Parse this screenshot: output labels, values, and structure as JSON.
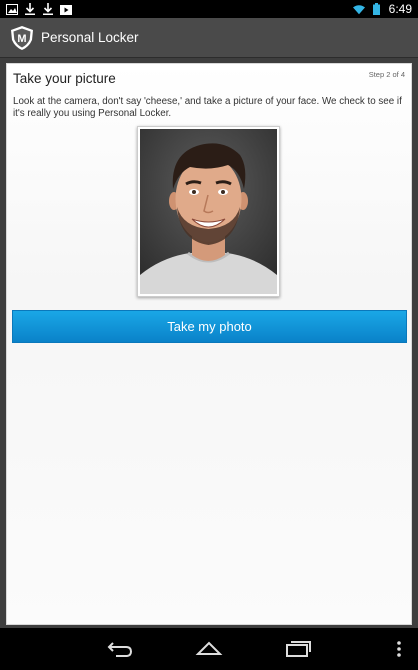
{
  "status_bar": {
    "time": "6:49",
    "icons": [
      "gallery-icon",
      "download-icon",
      "download-icon",
      "video-icon",
      "wifi-icon",
      "battery-icon"
    ]
  },
  "action_bar": {
    "logo_letter": "M",
    "title": "Personal Locker"
  },
  "card": {
    "title": "Take your picture",
    "step": "Step 2 of 4",
    "instructions": "Look at the camera, don't say 'cheese,' and take a picture of your face. We check to see if it's really you using Personal Locker.",
    "button_label": "Take my photo"
  },
  "colors": {
    "accent": "#0a95d9",
    "action_bar": "#4a4a4a",
    "wifi": "#33b5e5"
  },
  "nav_bar": {
    "icons": [
      "back-icon",
      "home-icon",
      "recent-apps-icon",
      "overflow-menu-icon"
    ]
  }
}
